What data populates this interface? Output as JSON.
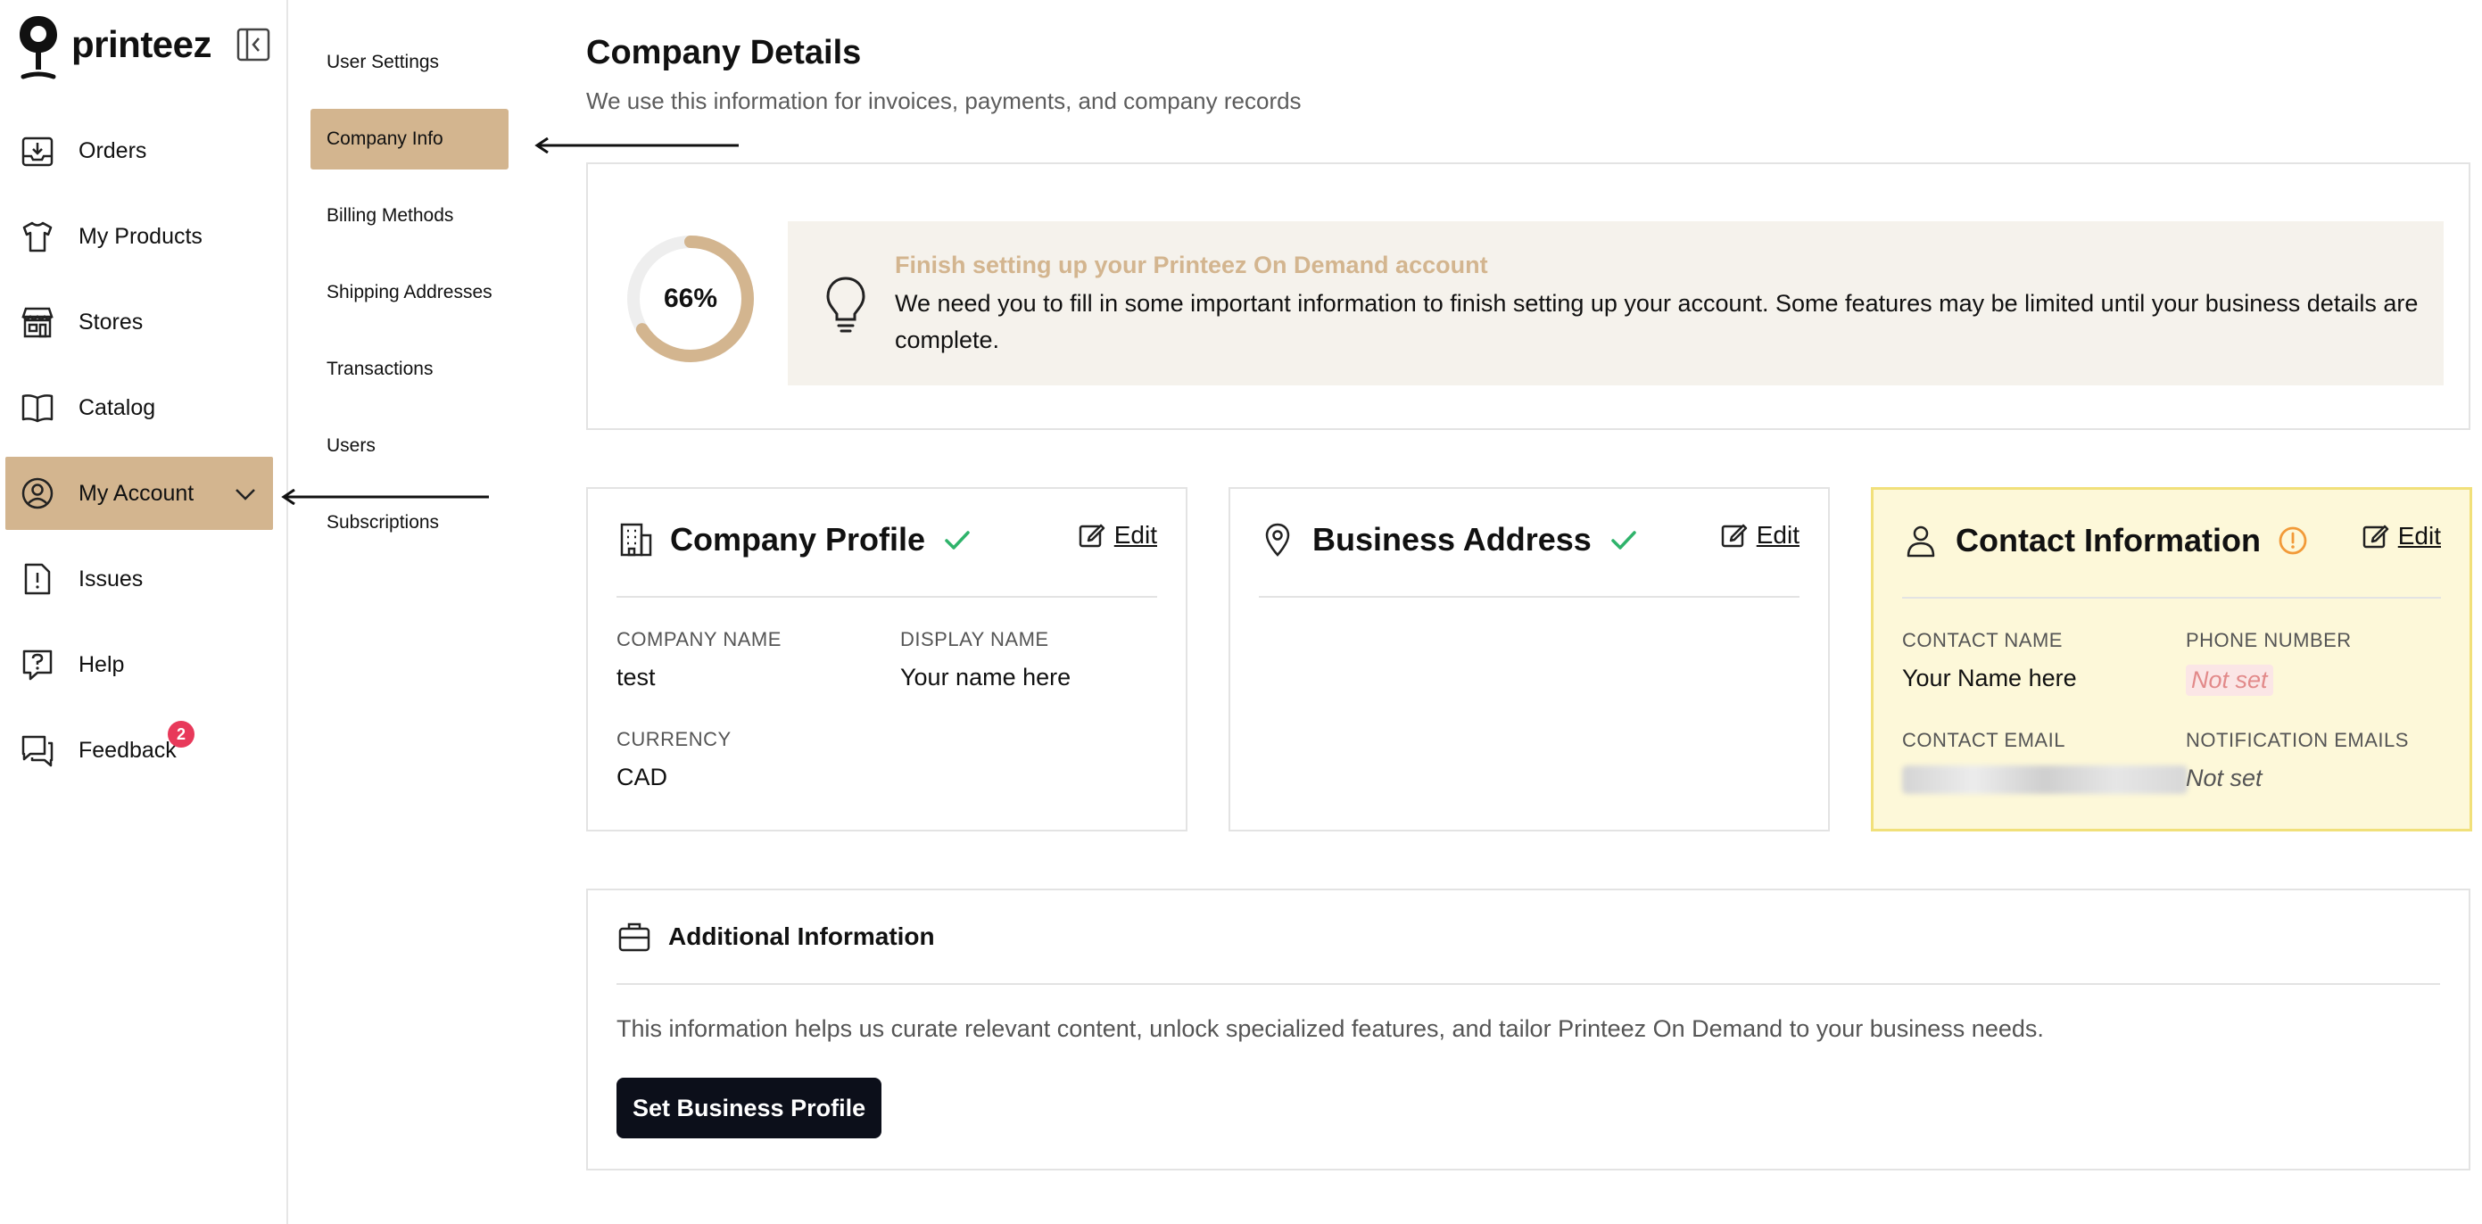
{
  "app": {
    "brand": "printeez"
  },
  "sidebar": {
    "items": [
      {
        "label": "Orders",
        "icon": "inbox-download-icon"
      },
      {
        "label": "My Products",
        "icon": "tshirt-icon"
      },
      {
        "label": "Stores",
        "icon": "store-icon"
      },
      {
        "label": "Catalog",
        "icon": "book-icon"
      },
      {
        "label": "My Account",
        "icon": "user-circle-icon",
        "active": true
      },
      {
        "label": "Issues",
        "icon": "file-alert-icon"
      },
      {
        "label": "Help",
        "icon": "help-bubble-icon"
      },
      {
        "label": "Feedback",
        "icon": "chat-icon",
        "badge": "2"
      }
    ]
  },
  "subnav": {
    "items": [
      {
        "label": "User Settings"
      },
      {
        "label": "Company Info",
        "active": true
      },
      {
        "label": "Billing Methods"
      },
      {
        "label": "Shipping Addresses"
      },
      {
        "label": "Transactions"
      },
      {
        "label": "Users"
      },
      {
        "label": "Subscriptions"
      }
    ]
  },
  "page": {
    "title": "Company Details",
    "subtitle": "We use this information for invoices, payments, and company records"
  },
  "progress": {
    "percent_label": "66%",
    "fraction": 0.66,
    "notice_title": "Finish setting up your Printeez On Demand account",
    "notice_text": "We need you to fill in some important information to finish setting up your account. Some features may be limited until your business details are complete."
  },
  "company_profile": {
    "title": "Company Profile",
    "edit": "Edit",
    "company_name_label": "COMPANY NAME",
    "company_name": "test",
    "display_name_label": "DISPLAY NAME",
    "display_name": "Your name here",
    "currency_label": "CURRENCY",
    "currency": "CAD"
  },
  "business_address": {
    "title": "Business Address",
    "edit": "Edit"
  },
  "contact_info": {
    "title": "Contact Information",
    "edit": "Edit",
    "contact_name_label": "CONTACT NAME",
    "contact_name": "Your Name here",
    "phone_label": "PHONE NUMBER",
    "phone": "Not set",
    "contact_email_label": "CONTACT EMAIL",
    "notification_label": "NOTIFICATION EMAILS",
    "notification": "Not set"
  },
  "additional": {
    "title": "Additional Information",
    "description": "This information helps us curate relevant content, unlock specialized features, and tailor Printeez On Demand to your business needs.",
    "button": "Set Business Profile"
  },
  "colors": {
    "accent": "#d3b58f",
    "success": "#2fb36b",
    "warning": "#f29a38",
    "badge": "#e8395a",
    "primary_button": "#0c0f1a"
  }
}
